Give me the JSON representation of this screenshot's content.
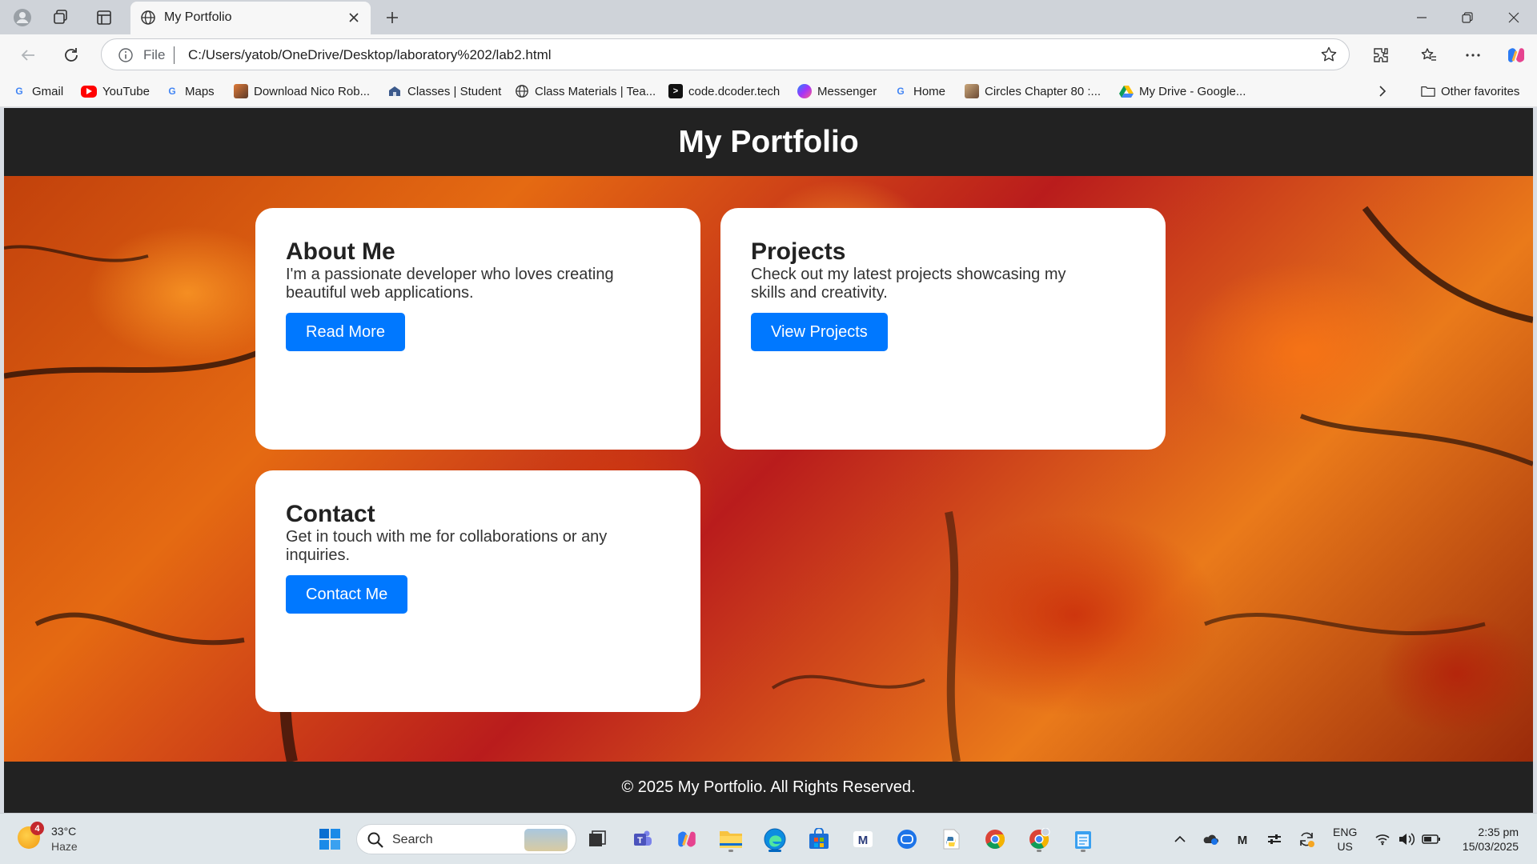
{
  "browser": {
    "tab_title": "My Portfolio",
    "address_scheme": "File",
    "address_url": "C:/Users/yatob/OneDrive/Desktop/laboratory%202/lab2.html",
    "bookmarks": [
      {
        "label": "Gmail",
        "icon": "google-icon"
      },
      {
        "label": "YouTube",
        "icon": "youtube-icon"
      },
      {
        "label": "Maps",
        "icon": "google-icon"
      },
      {
        "label": "Download Nico Rob...",
        "icon": "image-icon"
      },
      {
        "label": "Classes | Student",
        "icon": "school-icon"
      },
      {
        "label": "Class Materials | Tea...",
        "icon": "globe-icon"
      },
      {
        "label": "code.dcoder.tech",
        "icon": "code-icon"
      },
      {
        "label": "Messenger",
        "icon": "messenger-icon"
      },
      {
        "label": "Home",
        "icon": "google-icon"
      },
      {
        "label": "Circles Chapter 80 :...",
        "icon": "manga-icon"
      },
      {
        "label": "My Drive - Google...",
        "icon": "drive-icon"
      }
    ],
    "other_favorites": "Other favorites"
  },
  "page": {
    "site_title": "My Portfolio",
    "cards": [
      {
        "title": "About Me",
        "text": "I'm a passionate developer who loves creating beautiful web applications.",
        "button": "Read More"
      },
      {
        "title": "Projects",
        "text": "Check out my latest projects showcasing my skills and creativity.",
        "button": "View Projects"
      },
      {
        "title": "Contact",
        "text": "Get in touch with me for collaborations or any inquiries.",
        "button": "Contact Me"
      }
    ],
    "footer": "© 2025 My Portfolio. All Rights Reserved."
  },
  "taskbar": {
    "weather_temp": "33°C",
    "weather_desc": "Haze",
    "weather_badge": "4",
    "search_label": "Search",
    "lang_top": "ENG",
    "lang_bottom": "US",
    "time": "2:35 pm",
    "date": "15/03/2025"
  },
  "colors": {
    "header_bg": "#222222",
    "button_blue": "#0078ff",
    "card_bg": "#ffffff"
  }
}
